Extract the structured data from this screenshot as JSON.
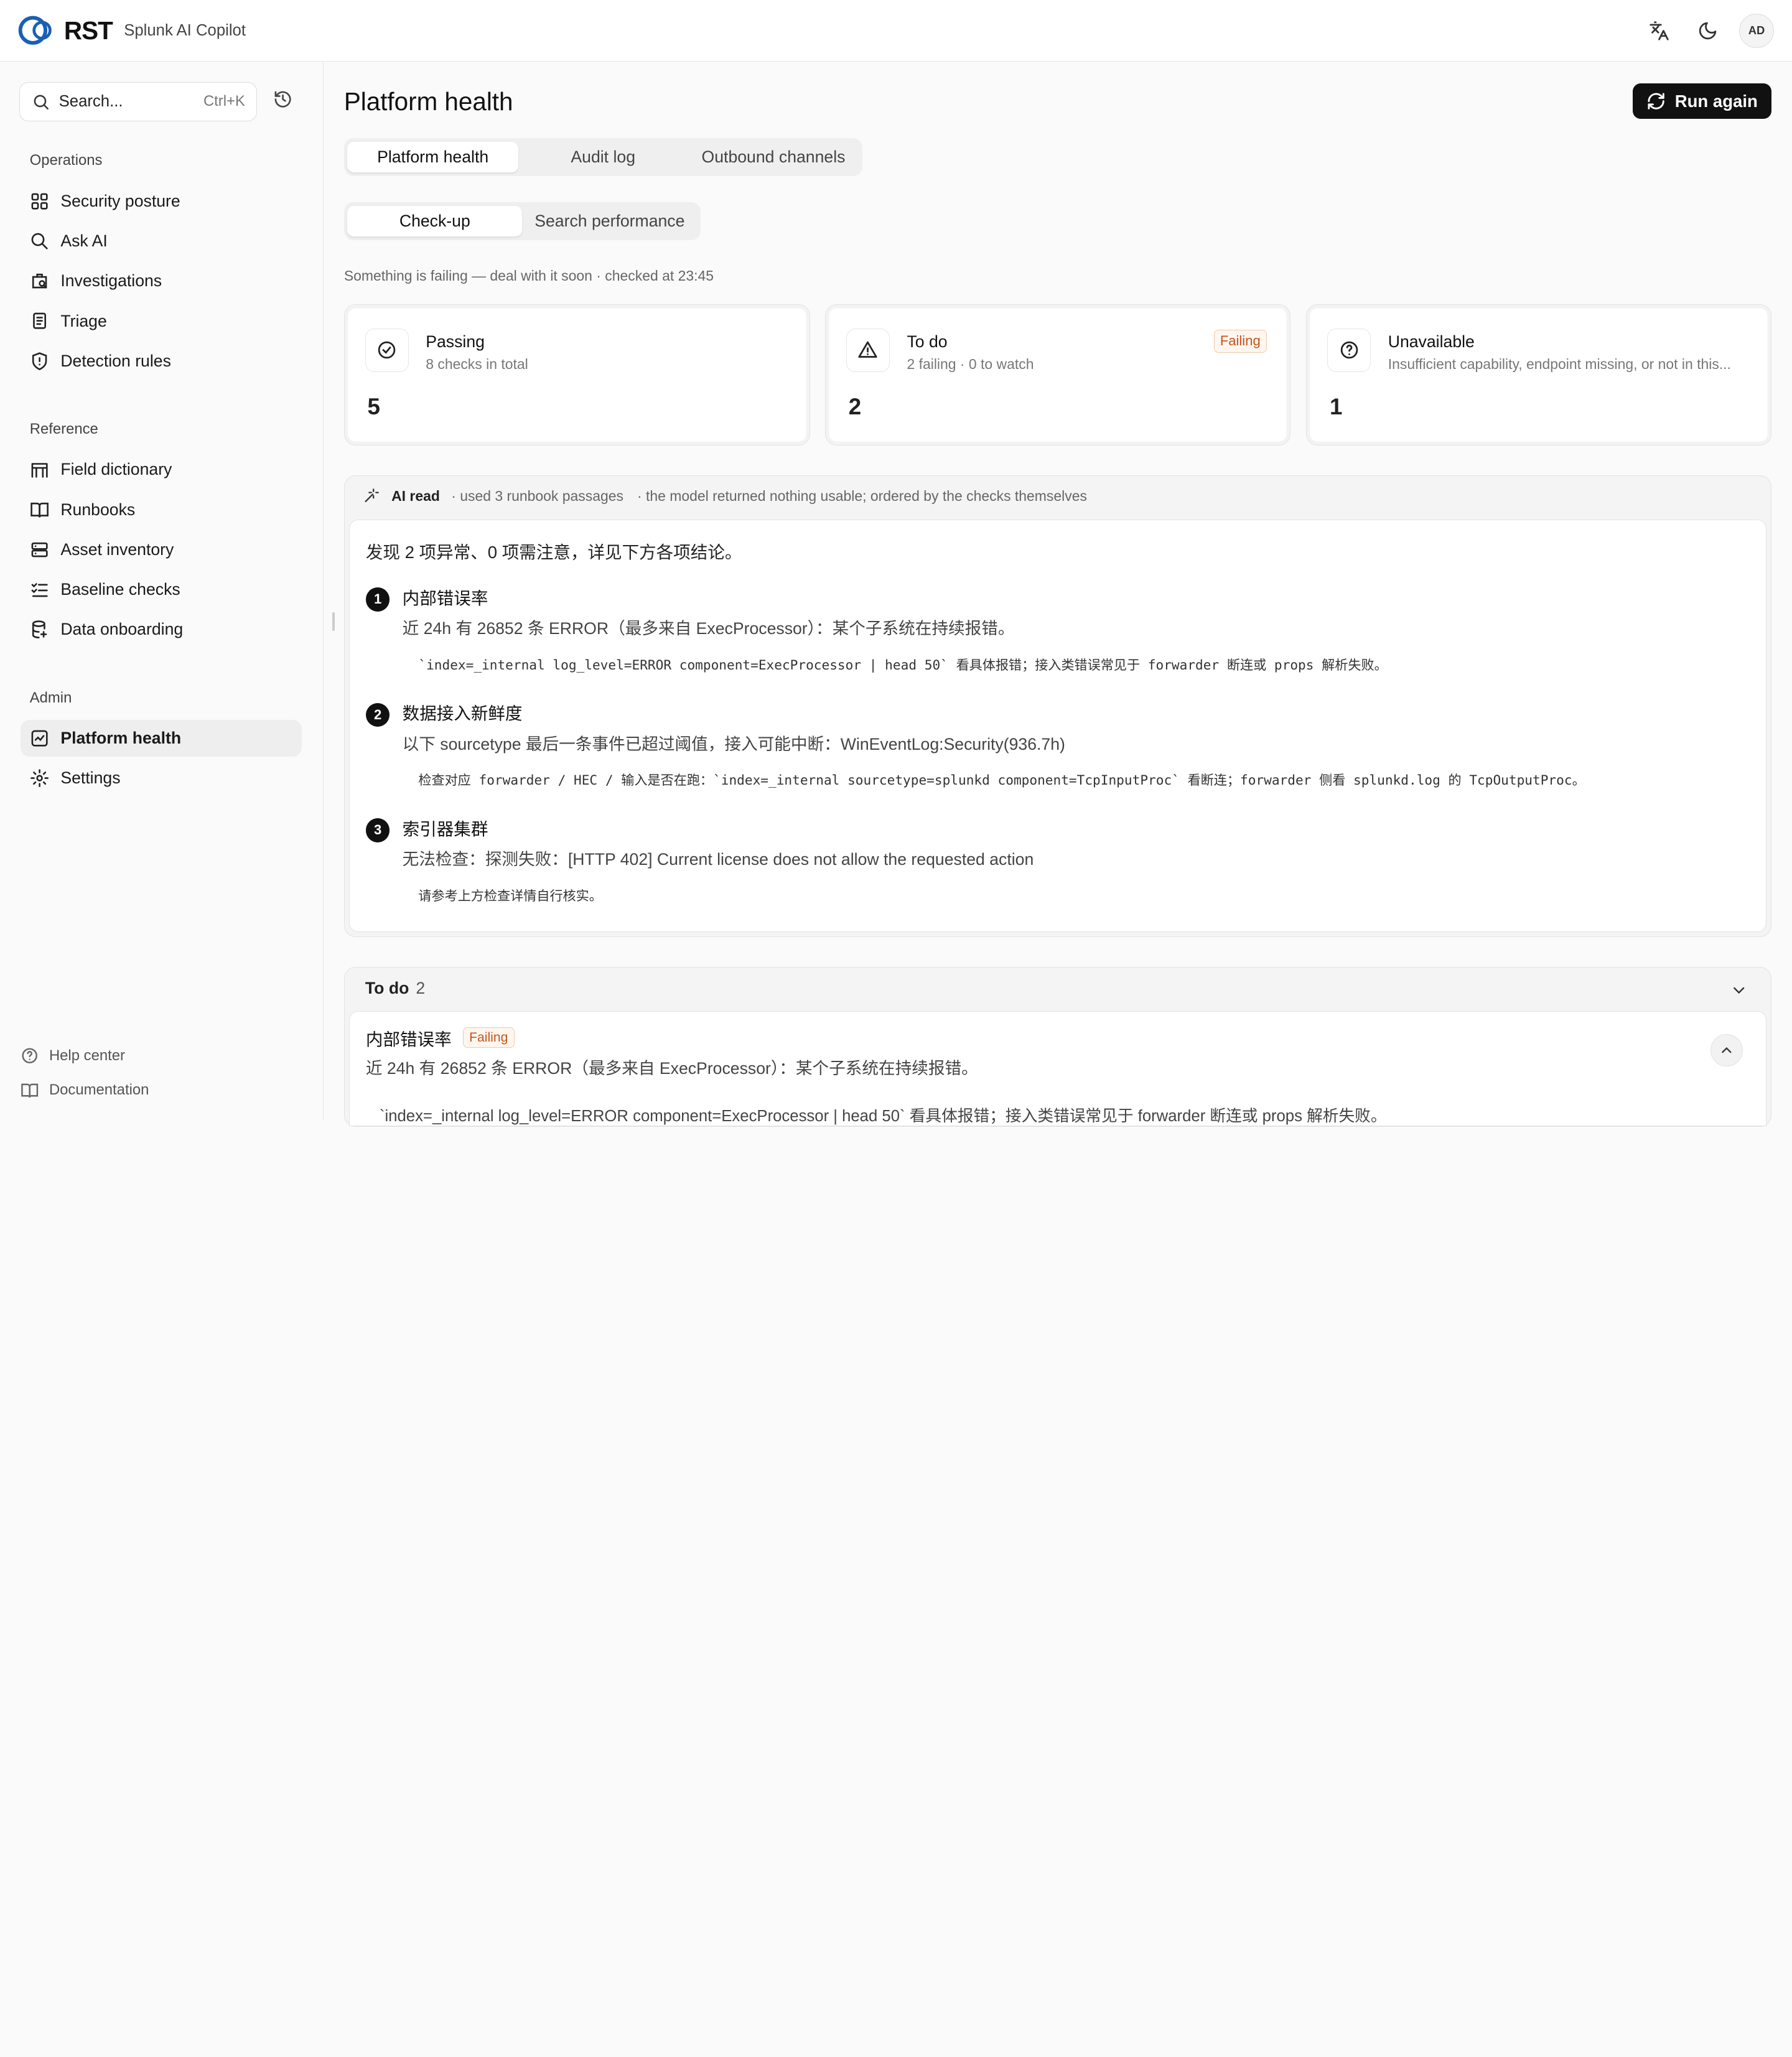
{
  "brand": {
    "logo_text": "RST",
    "app_name": "Splunk AI Copilot"
  },
  "topbar": {
    "avatar_initials": "AD",
    "translate_icon": "translate-icon",
    "theme_icon": "moon-icon"
  },
  "sidebar": {
    "search": {
      "placeholder": "Search...",
      "shortcut": "Ctrl+K"
    },
    "sections": [
      {
        "title": "Operations",
        "items": [
          {
            "label": "Security posture",
            "icon": "grid-icon"
          },
          {
            "label": "Ask AI",
            "icon": "search-icon"
          },
          {
            "label": "Investigations",
            "icon": "case-icon"
          },
          {
            "label": "Triage",
            "icon": "clipboard-icon"
          },
          {
            "label": "Detection rules",
            "icon": "shield-icon"
          }
        ]
      },
      {
        "title": "Reference",
        "items": [
          {
            "label": "Field dictionary",
            "icon": "table-icon"
          },
          {
            "label": "Runbooks",
            "icon": "book-icon"
          },
          {
            "label": "Asset inventory",
            "icon": "server-icon"
          },
          {
            "label": "Baseline checks",
            "icon": "checklist-icon"
          },
          {
            "label": "Data onboarding",
            "icon": "database-icon"
          }
        ]
      },
      {
        "title": "Admin",
        "items": [
          {
            "label": "Platform health",
            "icon": "activity-icon",
            "active": true
          },
          {
            "label": "Settings",
            "icon": "gear-icon"
          }
        ]
      }
    ],
    "footer": [
      {
        "label": "Help center",
        "icon": "help-icon"
      },
      {
        "label": "Documentation",
        "icon": "book-icon"
      }
    ]
  },
  "main": {
    "title": "Platform health",
    "run_button": "Run again",
    "tabs": [
      "Platform health",
      "Audit log",
      "Outbound channels"
    ],
    "active_tab": "Platform health",
    "subtabs": [
      "Check-up",
      "Search performance"
    ],
    "active_subtab": "Check-up",
    "status_line": "Something is failing — deal with it soon · checked at 23:45",
    "cards": [
      {
        "title": "Passing",
        "subtitle": "8 checks in total",
        "value": "5",
        "icon": "check-circle-icon",
        "badge": ""
      },
      {
        "title": "To do",
        "subtitle": "2 failing · 0 to watch",
        "value": "2",
        "icon": "warning-icon",
        "badge": "Failing"
      },
      {
        "title": "Unavailable",
        "subtitle": "Insufficient capability, endpoint missing, or not in this...",
        "value": "1",
        "icon": "question-icon",
        "badge": ""
      }
    ],
    "ai_read": {
      "label": "AI read",
      "meta1": "· used 3 runbook passages",
      "meta2": "· the model returned nothing usable; ordered by the checks themselves",
      "summary": "发现 2 项异常、0 项需注意，详见下方各项结论。",
      "findings": [
        {
          "num": "1",
          "title": "内部错误率",
          "desc": "近 24h 有 26852 条 ERROR（最多来自 ExecProcessor）：某个子系统在持续报错。",
          "code": "`index=_internal log_level=ERROR component=ExecProcessor | head 50` 看具体报错；接入类错误常见于 forwarder 断连或 props 解析失败。"
        },
        {
          "num": "2",
          "title": "数据接入新鲜度",
          "desc": "以下 sourcetype 最后一条事件已超过阈值，接入可能中断：WinEventLog:Security(936.7h)",
          "code": "检查对应 forwarder / HEC / 输入是否在跑：`index=_internal sourcetype=splunkd component=TcpInputProc` 看断连；forwarder 侧看 splunkd.log 的 TcpOutputProc。"
        },
        {
          "num": "3",
          "title": "索引器集群",
          "desc": "无法检查：探测失败：[HTTP 402] Current license does not allow the requested action",
          "code": "请参考上方检查详情自行核实。"
        }
      ]
    },
    "todo": {
      "title": "To do",
      "count": "2",
      "item": {
        "title": "内部错误率",
        "badge": "Failing",
        "desc": "近 24h 有 26852 条 ERROR（最多来自 ExecProcessor）：某个子系统在持续报错。",
        "code": "`index=_internal log_level=ERROR component=ExecProcessor | head 50` 看具体报错；接入类错误常见于 forwarder 断连或 props 解析失败。"
      }
    }
  },
  "colors": {
    "accent_blue": "#1a5fb4",
    "failing_orange": "#c2551c",
    "dark_button": "#111111"
  }
}
